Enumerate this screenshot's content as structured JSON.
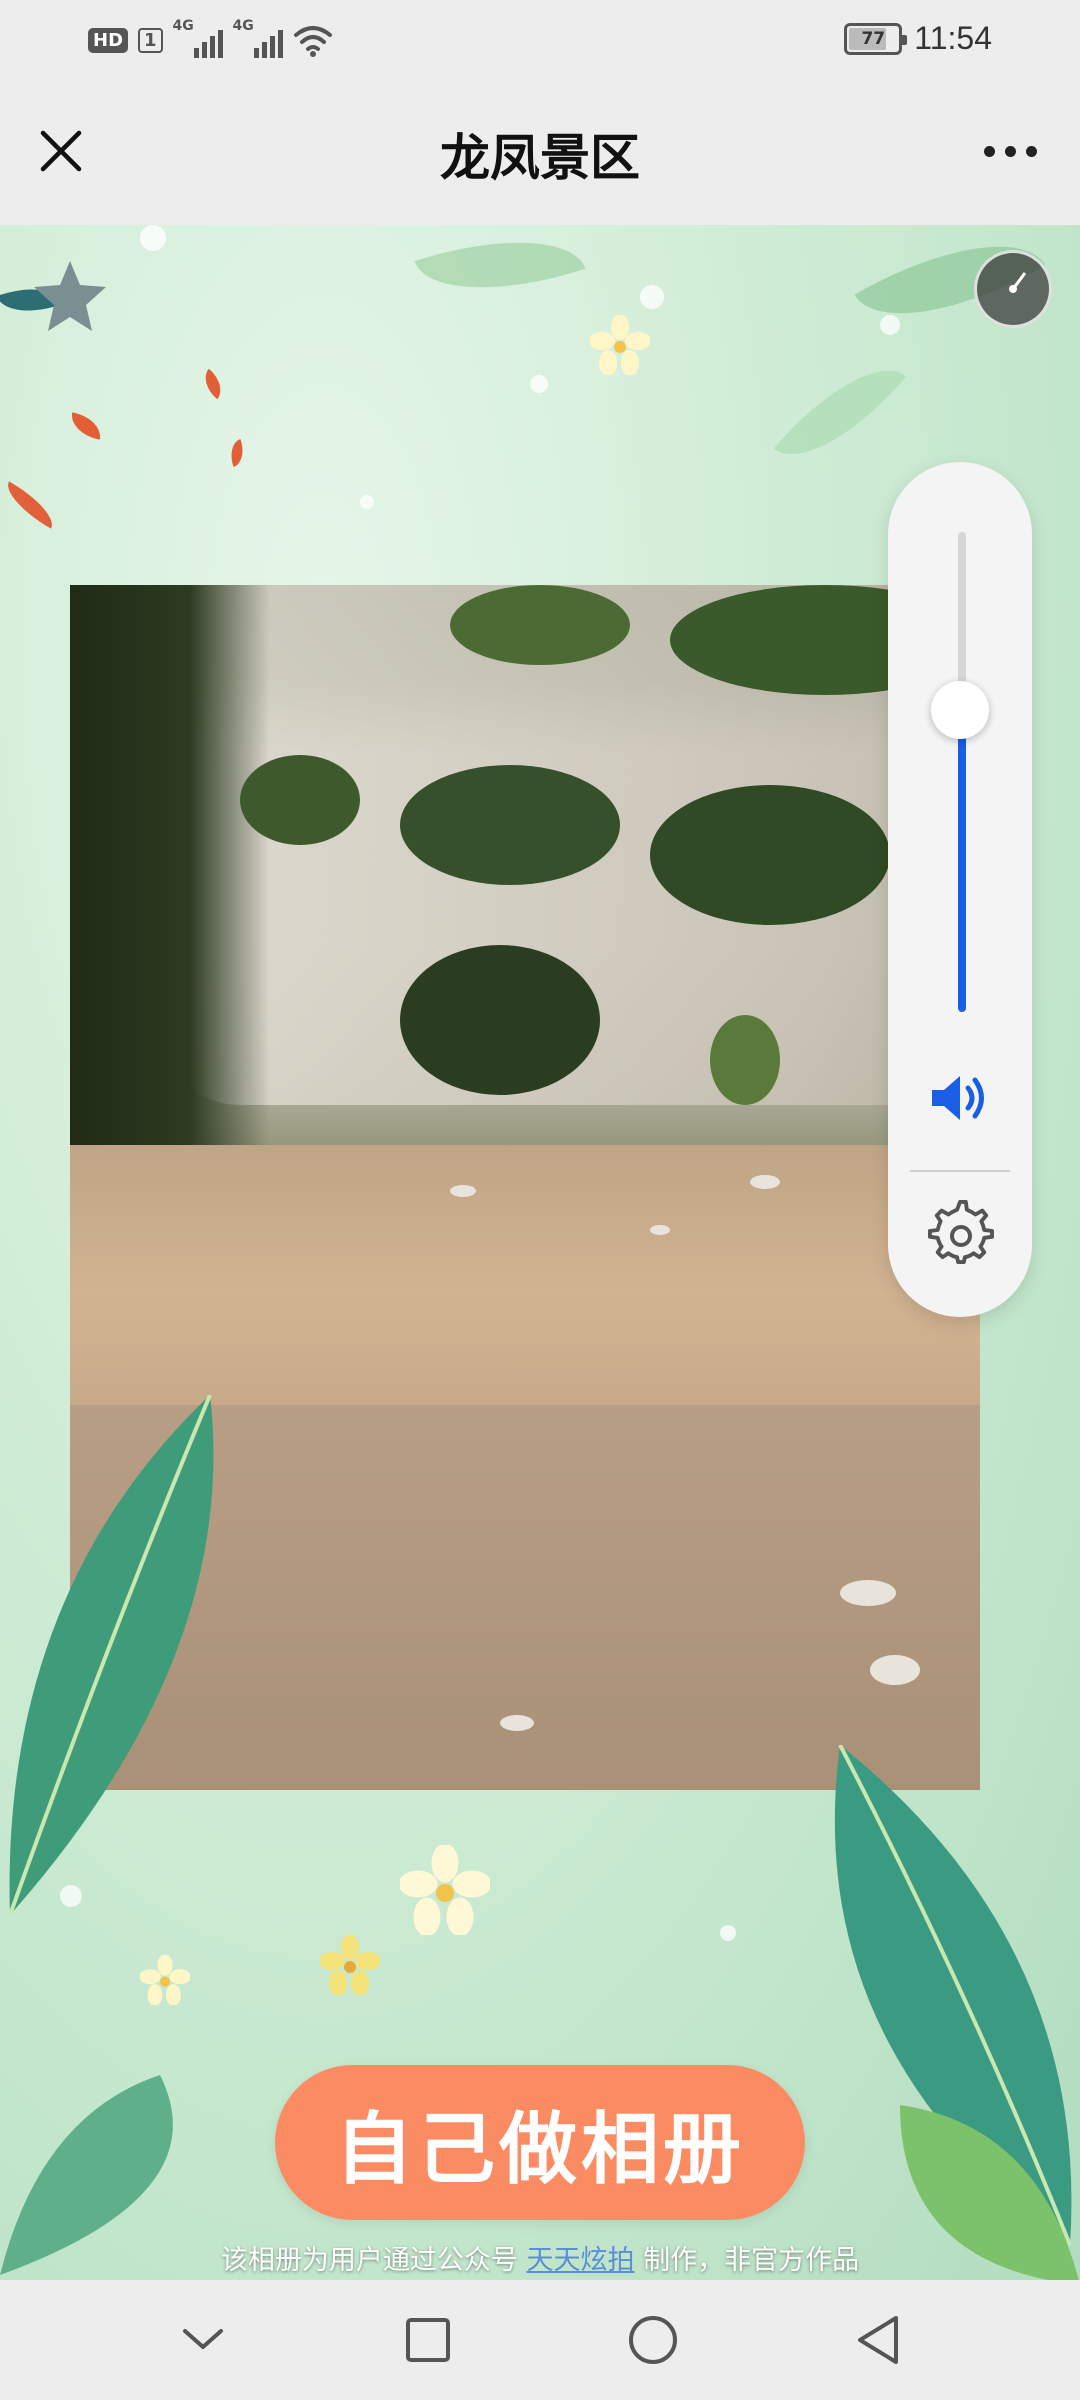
{
  "status_bar": {
    "hd": "HD",
    "sim": "1",
    "net1": "4G",
    "net2": "4G",
    "battery": "77",
    "battery_level": 0.77,
    "time": "11:54"
  },
  "header": {
    "title": "龙凤景区",
    "close_icon": "close-icon",
    "more_icon": "more-icon"
  },
  "album": {
    "photo": "river-canyon-photo",
    "cta_label": "自己做相册",
    "cta_color": "#fb8b63",
    "footer_before": "该相册为用户通过公众号",
    "footer_link": "天天炫拍",
    "footer_after": "制作，非官方作品"
  },
  "volume_panel": {
    "level": 0.63,
    "accent": "#1a5ee6",
    "speaker_icon": "speaker-icon",
    "settings_icon": "gear-icon"
  },
  "nav_bar": {
    "buttons": [
      "chevron-down-icon",
      "square-icon",
      "circle-icon",
      "triangle-back-icon"
    ]
  }
}
